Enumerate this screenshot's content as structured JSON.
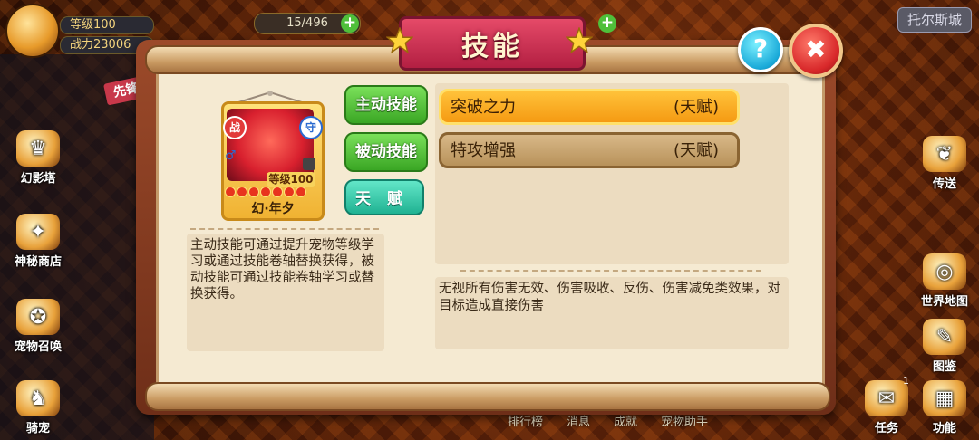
{
  "hud": {
    "level_label": "等级100",
    "power_label": "战力23006",
    "energy": "15/496",
    "city": "托尔斯城"
  },
  "left_menu": {
    "vanguard": "先锋",
    "items": [
      "幻影塔",
      "神秘商店",
      "宠物召唤",
      "骑宠"
    ]
  },
  "right_menu": {
    "items": [
      "传送",
      "世界地图",
      "图鉴",
      "功能",
      "任务"
    ],
    "task_badge": "1"
  },
  "bottom_menu": [
    "排行榜",
    "消息",
    "成就",
    "宠物助手"
  ],
  "dialog": {
    "title": "技能",
    "help_symbol": "?",
    "close_symbol": "✖"
  },
  "pet": {
    "name": "幻·年夕",
    "badge_left": "战",
    "badge_right": "守",
    "gender_symbol": "♂",
    "level_text": "等级100",
    "stars": 7
  },
  "tabs": {
    "active_skill": "主动技能",
    "passive_skill": "被动技能",
    "talent": "天赋"
  },
  "description": "主动技能可通过提升宠物等级学习或通过技能卷轴替换获得，被动技能可通过技能卷轴学习或替换获得。",
  "skills": [
    {
      "name": "突破之力",
      "tag": "(天赋)",
      "selected": true
    },
    {
      "name": "特攻增强",
      "tag": "(天赋)",
      "selected": false
    }
  ],
  "skill_effect": "无视所有伤害无效、伤害吸收、反伤、伤害减免类效果，对目标造成直接伤害",
  "colors": {
    "panel": "#f5ead2",
    "active_row": "#f59a12",
    "tab_green": "#3aa624",
    "tab_teal": "#20b292",
    "title_banner": "#b31f42"
  }
}
